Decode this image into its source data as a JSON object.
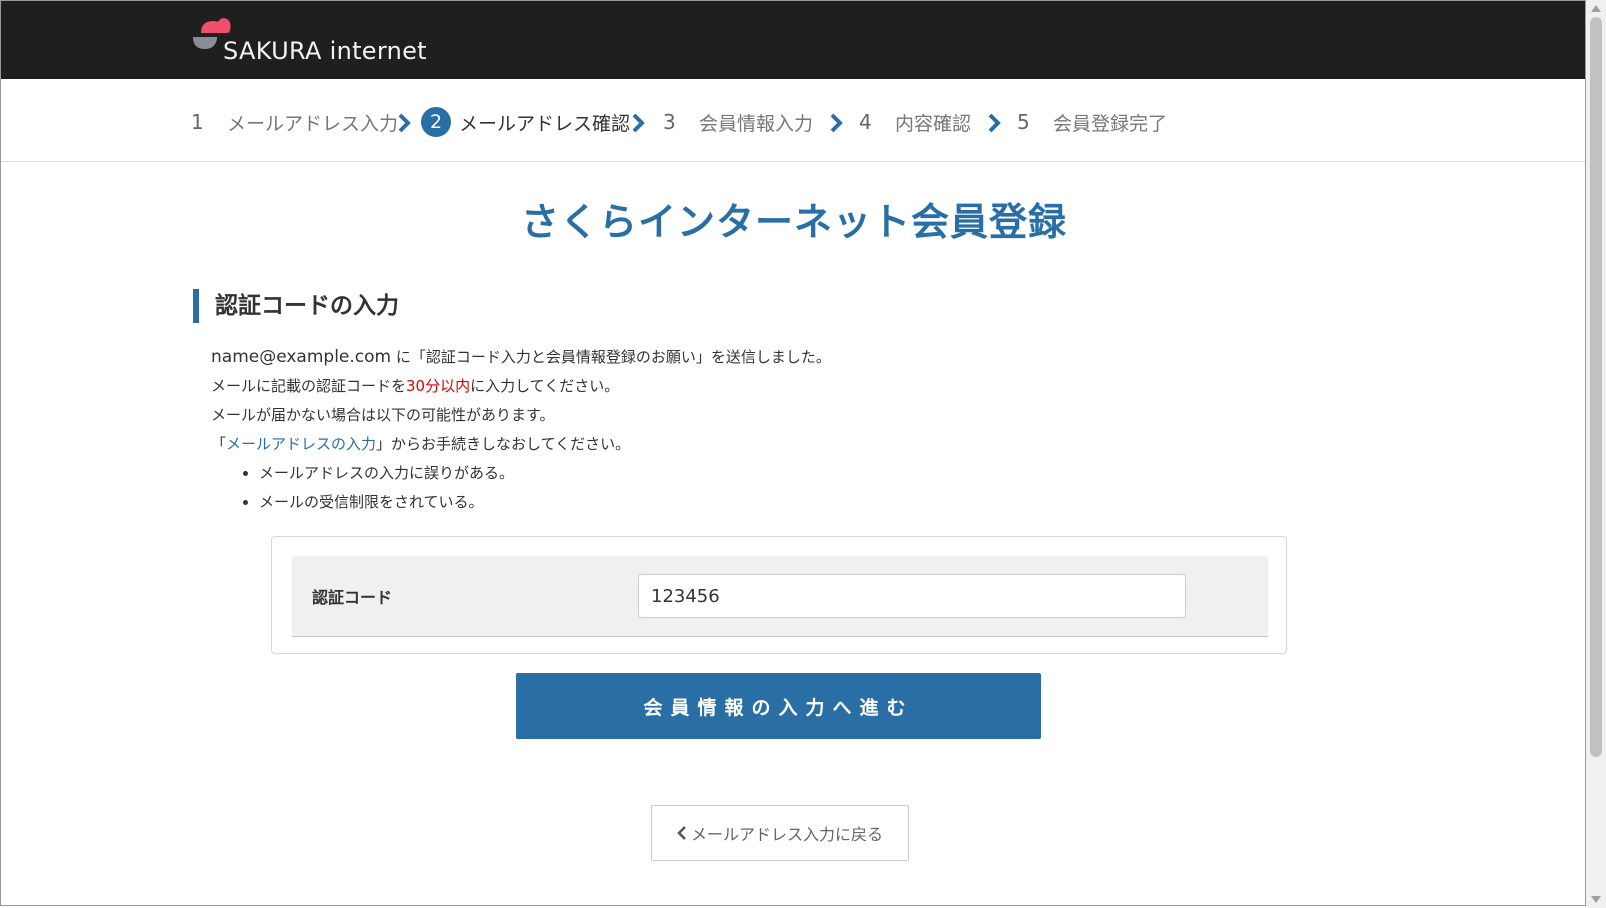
{
  "header": {
    "logo_text": "SAKURA internet",
    "brand_colors": {
      "header_bg": "#1f1f20",
      "logo_pink": "#f0506e",
      "logo_gray": "#8c8c96"
    }
  },
  "steps": [
    {
      "num": "1",
      "label": "メールアドレス入力",
      "active": false
    },
    {
      "num": "2",
      "label": "メールアドレス確認",
      "active": true
    },
    {
      "num": "3",
      "label": "会員情報入力",
      "active": false
    },
    {
      "num": "4",
      "label": "内容確認",
      "active": false
    },
    {
      "num": "5",
      "label": "会員登録完了",
      "active": false
    }
  ],
  "page": {
    "title": "さくらインターネット会員登録",
    "section_heading": "認証コードの入力",
    "accent_color": "#2a6ea6"
  },
  "description": {
    "email": "name@example.com",
    "line1_suffix": " に「認証コード入力と会員情報登録のお願い」を送信しました。",
    "line2_prefix": "メールに記載の認証コードを",
    "line2_highlight": "30分以内",
    "line2_suffix": "に入力してください。",
    "line3": "メールが届かない場合は以下の可能性があります。",
    "line4_open": "「",
    "line4_link": "メールアドレスの入力",
    "line4_suffix": "」からお手続きしなおしてください。",
    "bullets": [
      "メールアドレスの入力に誤りがある。",
      "メールの受信制限をされている。"
    ]
  },
  "form": {
    "code_label": "認証コード",
    "code_value": "123456"
  },
  "buttons": {
    "submit_label": "会員情報の入力へ進む",
    "back_label": "メールアドレス入力に戻る"
  }
}
